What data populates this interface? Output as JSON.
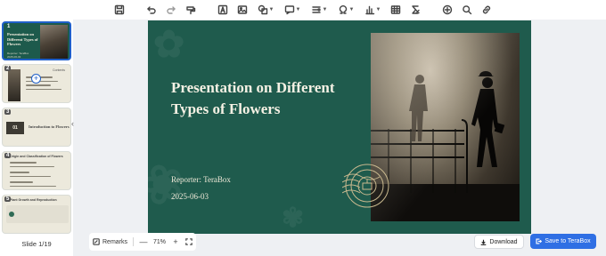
{
  "toolbar": {
    "icons": [
      "save-icon",
      "undo-icon",
      "redo-icon",
      "format-painter-icon",
      "text-box-icon",
      "image-icon",
      "shape-icon",
      "comment-icon",
      "arrange-icon",
      "symbol-icon",
      "chart-icon",
      "table-icon",
      "formula-icon",
      "add-icon",
      "search-icon",
      "link-icon"
    ]
  },
  "slides_panel": {
    "thumbnails": [
      {
        "number": "1",
        "title": "Presentation on Different Types of Flowers",
        "meta_line1": "Reporter: TeraBox",
        "meta_line2": "2025-06-03"
      },
      {
        "number": "2",
        "heading": "Contents"
      },
      {
        "number": "3",
        "badge": "01",
        "title": "Introduction to Flowers"
      },
      {
        "number": "4",
        "title": "Origin and Classification of Flowers"
      },
      {
        "number": "5",
        "title": "Plant Growth and Reproduction"
      }
    ],
    "slide_count": "Slide 1/19"
  },
  "slide": {
    "title": "Presentation on Different Types of Flowers",
    "reporter": "Reporter: TeraBox",
    "date": "2025-06-03",
    "background_color": "#1f5b4d"
  },
  "bottom_bar": {
    "remarks_label": "Remarks",
    "zoom_out": "—",
    "zoom_level": "71%",
    "zoom_in": "+",
    "download_label": "Download",
    "save_label": "Save to TeraBox"
  }
}
